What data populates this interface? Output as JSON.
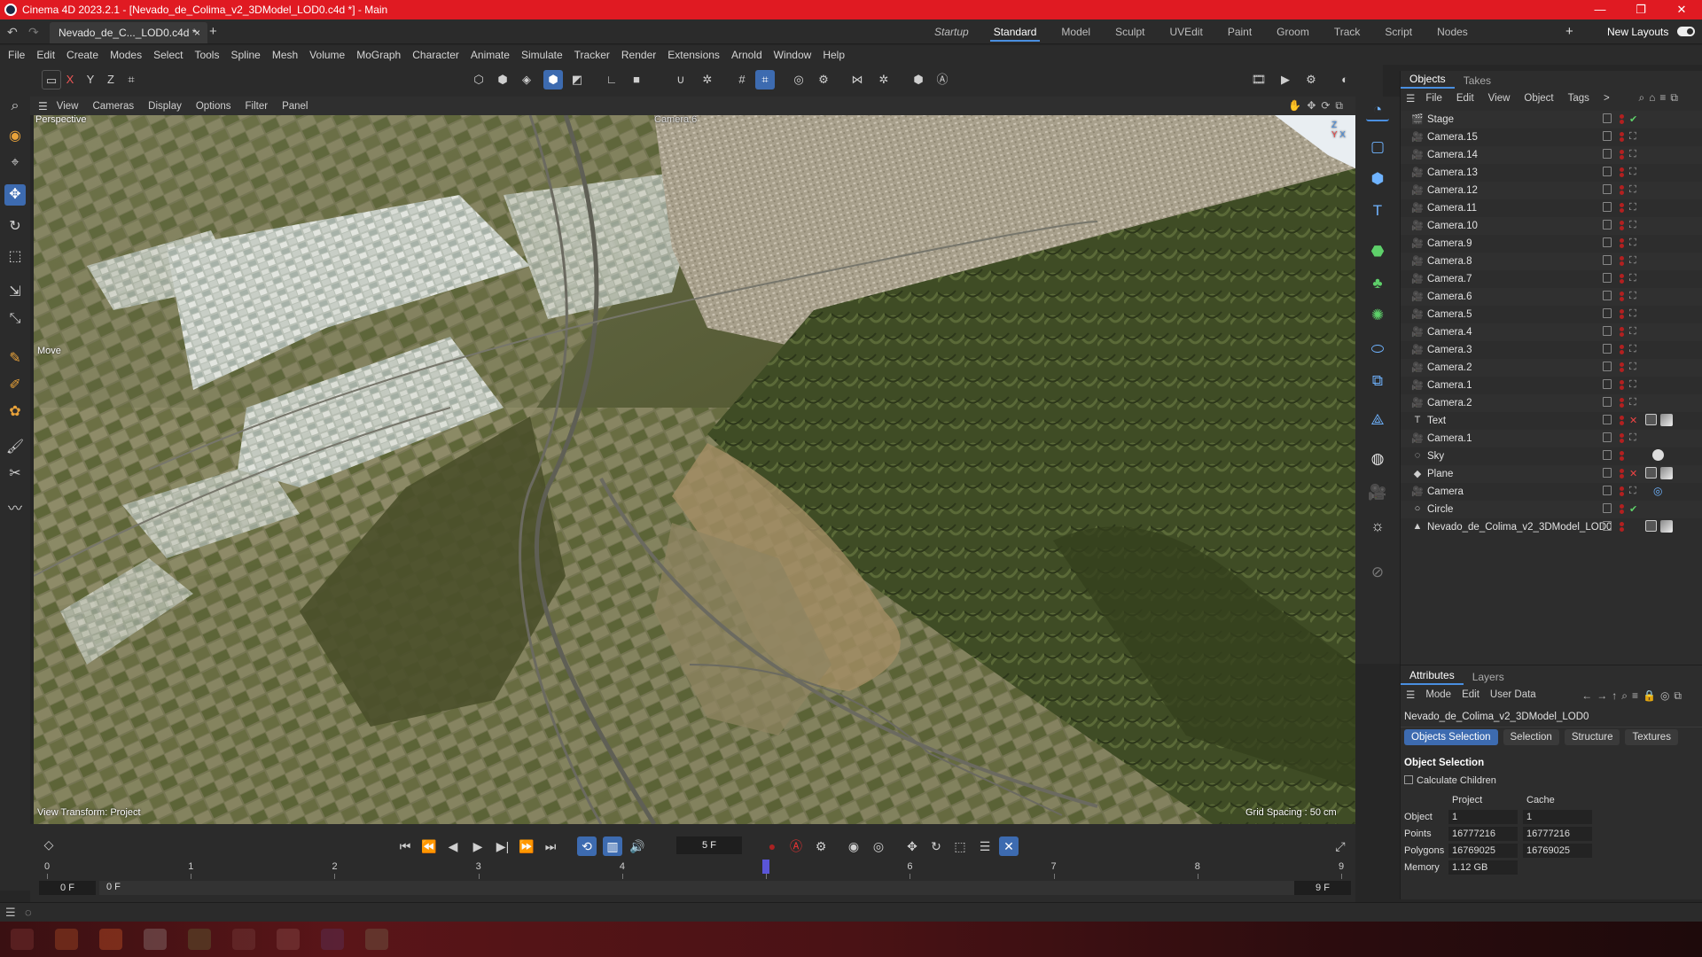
{
  "window": {
    "title": "Cinema 4D 2023.2.1 - [Nevado_de_Colima_v2_3DModel_LOD0.c4d *] - Main",
    "controls": [
      "—",
      "❐",
      "✕"
    ]
  },
  "tabs": {
    "document": "Nevado_de_C..._LOD0.c4d *",
    "close": "×",
    "add": "+"
  },
  "layouts": {
    "items": [
      "Startup",
      "Standard",
      "Model",
      "Sculpt",
      "UVEdit",
      "Paint",
      "Groom",
      "Track",
      "Script",
      "Nodes"
    ],
    "active": "Standard",
    "plus": "+",
    "new_layouts": "New Layouts"
  },
  "menu": [
    "File",
    "Edit",
    "Create",
    "Modes",
    "Select",
    "Tools",
    "Spline",
    "Mesh",
    "Volume",
    "MoGraph",
    "Character",
    "Animate",
    "Simulate",
    "Tracker",
    "Render",
    "Extensions",
    "Arnold",
    "Window",
    "Help"
  ],
  "toolbar": {
    "axis_x": "X",
    "axis_y": "Y",
    "axis_z": "Z"
  },
  "viewport": {
    "menu": [
      "View",
      "Cameras",
      "Display",
      "Options",
      "Filter",
      "Panel"
    ],
    "camera_label": "Perspective",
    "camera_name": "Camera.6",
    "tool_label": "Move",
    "view_transform": "View Transform: Project",
    "grid_spacing": "Grid Spacing : 50 cm"
  },
  "objects_panel": {
    "tabs": [
      "Objects",
      "Takes"
    ],
    "menu": [
      "File",
      "Edit",
      "View",
      "Object",
      "Tags",
      ">"
    ],
    "items": [
      {
        "name": "Stage",
        "icon": "🎬",
        "tag": "✔",
        "tag_color": "green"
      },
      {
        "name": "Camera.15",
        "icon": "🎥",
        "tag": "⛶",
        "tag_color": "grey"
      },
      {
        "name": "Camera.14",
        "icon": "🎥",
        "tag": "⛶",
        "tag_color": "grey"
      },
      {
        "name": "Camera.13",
        "icon": "🎥",
        "tag": "⛶",
        "tag_color": "grey"
      },
      {
        "name": "Camera.12",
        "icon": "🎥",
        "tag": "⛶",
        "tag_color": "grey"
      },
      {
        "name": "Camera.11",
        "icon": "🎥",
        "tag": "⛶",
        "tag_color": "grey"
      },
      {
        "name": "Camera.10",
        "icon": "🎥",
        "tag": "⛶",
        "tag_color": "grey"
      },
      {
        "name": "Camera.9",
        "icon": "🎥",
        "tag": "⛶",
        "tag_color": "grey"
      },
      {
        "name": "Camera.8",
        "icon": "🎥",
        "tag": "⛶",
        "tag_color": "grey"
      },
      {
        "name": "Camera.7",
        "icon": "🎥",
        "tag": "⛶",
        "tag_color": "grey"
      },
      {
        "name": "Camera.6",
        "icon": "🎥",
        "tag": "⛶",
        "tag_color": "grey"
      },
      {
        "name": "Camera.5",
        "icon": "🎥",
        "tag": "⛶",
        "tag_color": "grey"
      },
      {
        "name": "Camera.4",
        "icon": "🎥",
        "tag": "⛶",
        "tag_color": "grey"
      },
      {
        "name": "Camera.3",
        "icon": "🎥",
        "tag": "⛶",
        "tag_color": "grey"
      },
      {
        "name": "Camera.2",
        "icon": "🎥",
        "tag": "⛶",
        "tag_color": "grey"
      },
      {
        "name": "Camera.1",
        "icon": "🎥",
        "tag": "⛶",
        "tag_color": "grey"
      },
      {
        "name": "Camera.2",
        "icon": "🎥",
        "tag": "⛶",
        "tag_color": "grey"
      },
      {
        "name": "Text",
        "icon": "T",
        "tag": "✕",
        "tag_color": "red"
      },
      {
        "name": "Camera.1",
        "icon": "🎥",
        "tag": "⛶",
        "tag_color": "grey"
      },
      {
        "name": "Sky",
        "icon": "◌",
        "tag": "",
        "tag_color": "grey"
      },
      {
        "name": "Plane",
        "icon": "◆",
        "tag": "✕",
        "tag_color": "red"
      },
      {
        "name": "Camera",
        "icon": "🎥",
        "tag": "⛶",
        "tag_color": "grey"
      },
      {
        "name": "Circle",
        "icon": "○",
        "tag": "✔",
        "tag_color": "green"
      },
      {
        "name": "Nevado_de_Colima_v2_3DModel_LOD0",
        "icon": "▲",
        "tag": "",
        "tag_color": "grey"
      }
    ]
  },
  "attributes_panel": {
    "tabs": [
      "Attributes",
      "Layers"
    ],
    "menu": [
      "Mode",
      "Edit",
      "User Data"
    ],
    "object_name": "Nevado_de_Colima_v2_3DModel_LOD0",
    "subtabs": [
      "Objects Selection",
      "Selection",
      "Structure",
      "Textures"
    ],
    "section_title": "Object Selection",
    "calculate_children": "Calculate Children",
    "col_project": "Project",
    "col_cache": "Cache",
    "stats": [
      {
        "label": "Object",
        "project": "1",
        "cache": "1"
      },
      {
        "label": "Points",
        "project": "16777216",
        "cache": "16777216"
      },
      {
        "label": "Polygons",
        "project": "16769025",
        "cache": "16769025"
      },
      {
        "label": "Memory",
        "project": "1.12 GB",
        "cache": ""
      }
    ]
  },
  "timeline": {
    "current_frame": "5 F",
    "ruler": [
      "0",
      "1",
      "2",
      "3",
      "4",
      "5",
      "6",
      "7",
      "8",
      "9"
    ],
    "playhead_frame": 5,
    "frame_count": 9,
    "start_frame": "0 F",
    "range_start": "0 F",
    "range_end": "9 F",
    "end_frame": "9 F"
  },
  "colors": {
    "titlebar": "#e01a22",
    "accent": "#3d6bb0",
    "panel": "#2d2d2d"
  }
}
